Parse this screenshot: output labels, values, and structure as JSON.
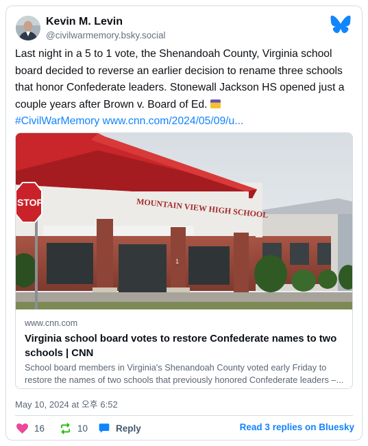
{
  "author": {
    "name": "Kevin M. Levin",
    "handle": "@civilwarmemory.bsky.social"
  },
  "post": {
    "text": "Last night in a 5 to 1 vote, the Shenandoah County, Virginia school board decided to reverse an earlier decision to rename three schools that honor Confederate leaders. Stonewall Jackson HS opened just a couple years after Brown v. Board of Ed.",
    "emoji": "ballot-box-emoji",
    "hashtag": "#CivilWarMemory",
    "link": "www.cnn.com/2024/05/09/u..."
  },
  "embed": {
    "image_sign": "MOUNTAIN VIEW HIGH SCHOOL",
    "stop_sign": "STOP",
    "door_number": "1",
    "domain": "www.cnn.com",
    "title": "Virginia school board votes to restore Confederate names to two schools | CNN",
    "description": "School board members in Virginia's Shenandoah County voted early Friday to restore the names of two schools that previously honored Confederate leaders –..."
  },
  "timestamp": "May 10, 2024 at 오후 6:52",
  "actions": {
    "likes": "16",
    "reposts": "10",
    "reply_label": "Reply",
    "read_replies_label": "Read 3 replies on Bluesky"
  },
  "colors": {
    "accent": "#1083fe",
    "like": "#ec4899",
    "repost": "#20bc07",
    "roof": "#c8262a",
    "brick": "#9c4a3a"
  }
}
